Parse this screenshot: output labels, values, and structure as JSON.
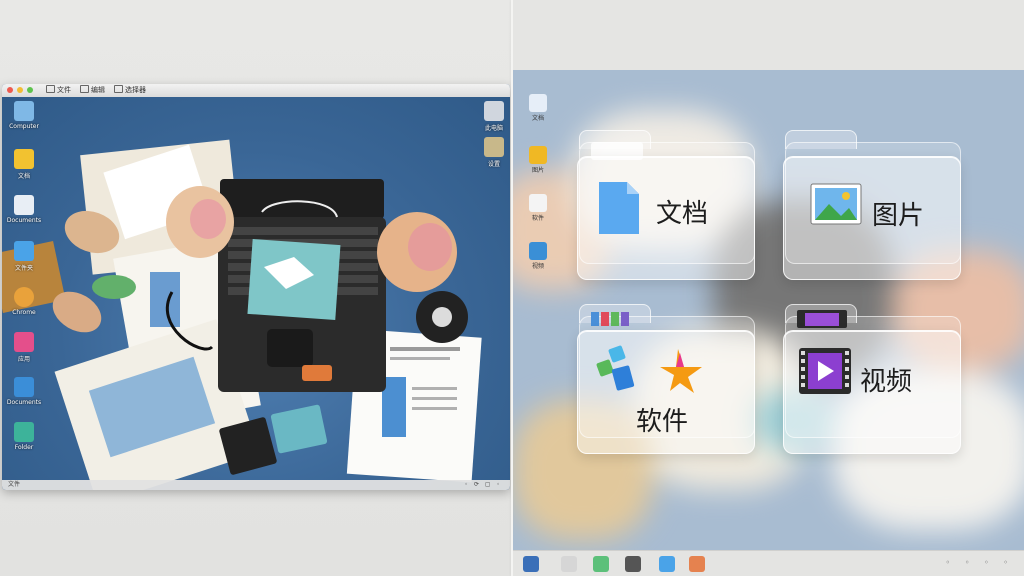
{
  "left": {
    "titlebar": {
      "items": [
        "文件",
        "编辑",
        "选择器"
      ]
    },
    "desktop_icons": [
      {
        "label": "Computer",
        "icon": "computer-icon",
        "color": "#7fb8e6"
      },
      {
        "label": "文档",
        "icon": "document-icon",
        "color": "#f2c230"
      },
      {
        "label": "Documents",
        "icon": "document-icon",
        "color": "#e8eef5"
      },
      {
        "label": "文件夹",
        "icon": "folder-icon",
        "color": "#4aa3e8"
      },
      {
        "label": "Chrome",
        "icon": "chrome-icon",
        "color": "#e9a23b"
      },
      {
        "label": "应用",
        "icon": "app-icon",
        "color": "#e44f8b"
      },
      {
        "label": "Documents",
        "icon": "folder-icon",
        "color": "#3b8ed8"
      },
      {
        "label": "Folder",
        "icon": "book-icon",
        "color": "#3db39a"
      }
    ],
    "desktop_icons_right": [
      {
        "label": "此电脑",
        "icon": "trash-icon",
        "color": "#d0d6de"
      },
      {
        "label": "设置",
        "icon": "gear-icon",
        "color": "#c8b88a"
      }
    ],
    "statusbar": {
      "left": "文件",
      "right": "◦ ⟳ ▢ ◦"
    }
  },
  "right": {
    "sidebar": [
      {
        "label": "文档",
        "icon": "document-icon",
        "color": "#e6eef8"
      },
      {
        "label": "图片",
        "icon": "image-icon",
        "color": "#f0b824"
      },
      {
        "label": "软件",
        "icon": "apps-icon",
        "color": "#f4f4f4"
      },
      {
        "label": "视频",
        "icon": "video-icon",
        "color": "#3a8fd6"
      }
    ],
    "folders": [
      {
        "title": "文档",
        "icon": "document-icon"
      },
      {
        "title": "图片",
        "icon": "image-icon"
      },
      {
        "title": "软件",
        "icon": "apps-icon"
      },
      {
        "title": "视频",
        "icon": "video-icon"
      }
    ],
    "colors": {
      "accent_blue": "#5aa9f0",
      "video_purple": "#8c3fd0",
      "apps_orange": "#f59a12"
    }
  }
}
